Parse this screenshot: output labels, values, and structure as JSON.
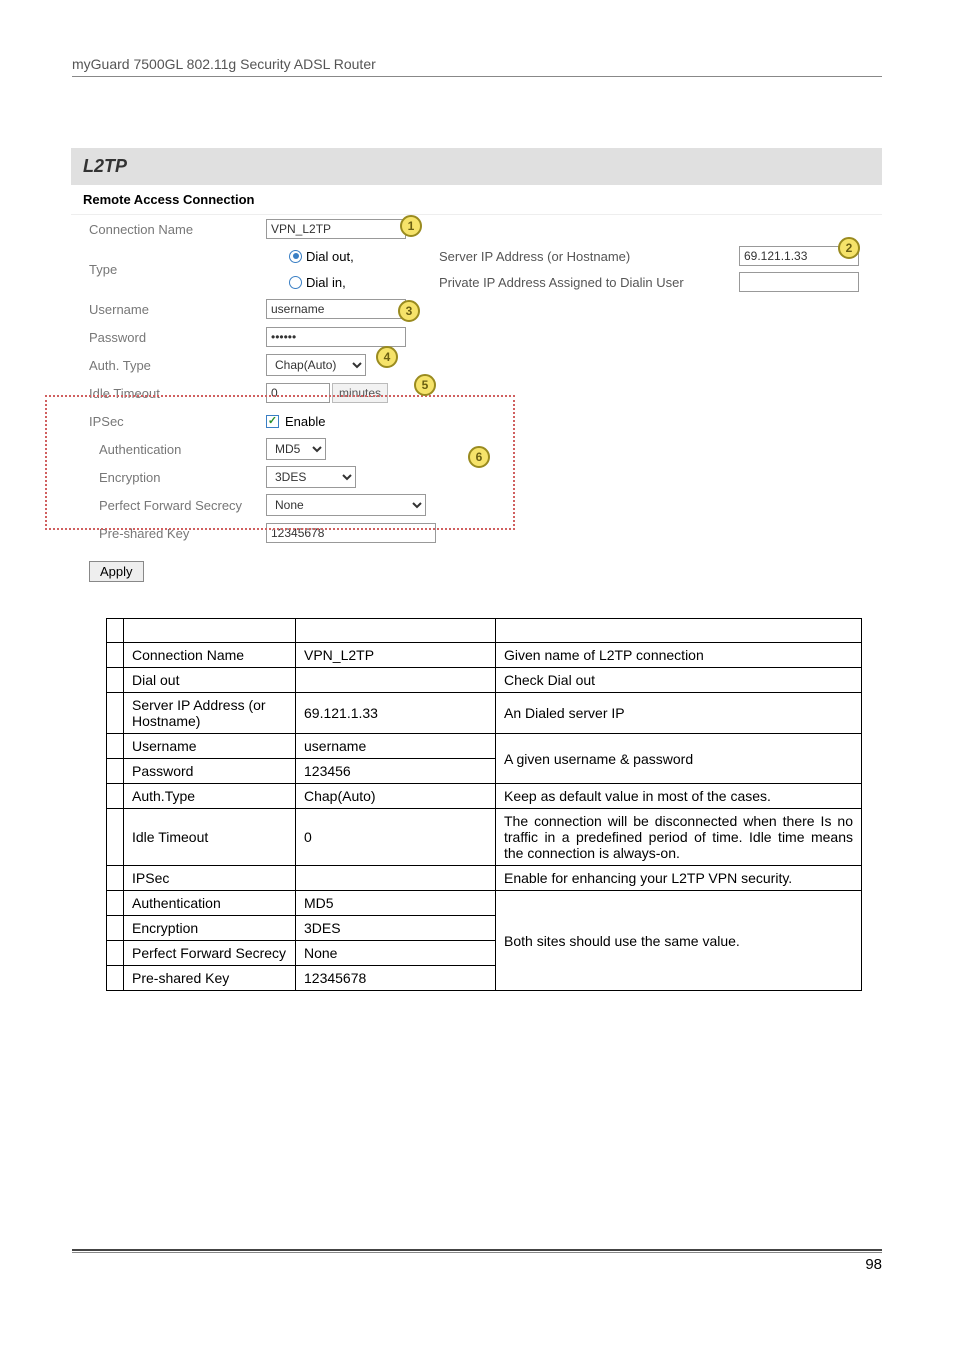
{
  "header": "myGuard 7500GL 802.11g Security ADSL Router",
  "panel": {
    "title": "L2TP",
    "section": "Remote Access Connection",
    "fields": {
      "connection_name_label": "Connection Name",
      "connection_name_value": "VPN_L2TP",
      "type_label": "Type",
      "dial_out_label": "Dial out,",
      "dial_in_label": "Dial in,",
      "server_ip_label": "Server IP Address (or Hostname)",
      "server_ip_value": "69.121.1.33",
      "private_ip_label": "Private IP Address Assigned to Dialin User",
      "private_ip_value": "",
      "username_label": "Username",
      "username_value": "username",
      "password_label": "Password",
      "password_value": "••••••",
      "auth_type_label": "Auth. Type",
      "auth_type_value": "Chap(Auto)",
      "idle_timeout_label": "Idle Timeout",
      "idle_timeout_value": "0",
      "idle_timeout_unit": "minutes",
      "ipsec_label": "IPSec",
      "ipsec_enable_label": "Enable",
      "authentication_label": "Authentication",
      "authentication_value": "MD5",
      "encryption_label": "Encryption",
      "encryption_value": "3DES",
      "pfs_label": "Perfect Forward Secrecy",
      "pfs_value": "None",
      "psk_label": "Pre-shared Key",
      "psk_value": "12345678",
      "apply_label": "Apply"
    }
  },
  "callouts": {
    "c1": "1",
    "c2": "2",
    "c3": "3",
    "c4": "4",
    "c5": "5",
    "c6": "6"
  },
  "desc_table": {
    "rows": [
      {
        "field": "Connection Name",
        "value": "VPN_L2TP",
        "desc": "Given name of L2TP connection"
      },
      {
        "field": "Dial out",
        "value": "",
        "desc": "Check Dial out"
      },
      {
        "field": "Server IP Address (or Hostname)",
        "value": "69.121.1.33",
        "desc": "An Dialed server IP"
      },
      {
        "field": "Username",
        "value": "username",
        "desc_merged": "A given username & password"
      },
      {
        "field": "Password",
        "value": "123456"
      },
      {
        "field": "Auth.Type",
        "value": "Chap(Auto)",
        "desc": "Keep as default value in most of the cases."
      },
      {
        "field": "Idle Timeout",
        "value": "0",
        "desc": "The connection will be disconnected when there Is no traffic in a predefined period of time. Idle time   means the connection is always-on."
      },
      {
        "field": "IPSec",
        "value": "",
        "desc": "Enable for enhancing your L2TP VPN security."
      },
      {
        "field": "Authentication",
        "value": "MD5",
        "desc_merged": "Both sites should use the same value."
      },
      {
        "field": "Encryption",
        "value": "3DES"
      },
      {
        "field": "Perfect Forward Secrecy",
        "value": "None"
      },
      {
        "field": "Pre-shared Key",
        "value": "12345678"
      }
    ]
  },
  "page_number": "98"
}
